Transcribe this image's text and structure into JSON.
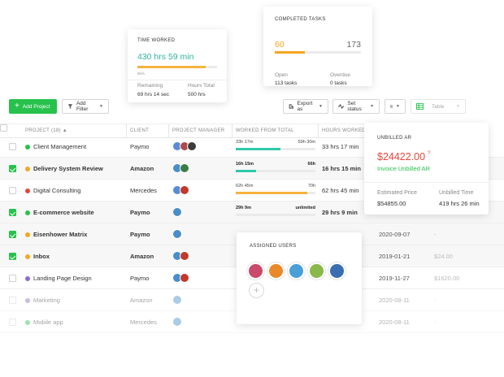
{
  "time_worked": {
    "title": "TIME WORKED",
    "total": "430 hrs 59 min",
    "percent": "86%",
    "percent_value": 0.86,
    "remaining_label": "Remaining",
    "remaining_value": "69 hrs 14 sec",
    "hours_total_label": "Hours Total",
    "hours_total_value": "500 hrs"
  },
  "completed_tasks": {
    "title": "COMPLETED TASKS",
    "done": "60",
    "total": "173",
    "done_fraction": 0.35,
    "open_label": "Open",
    "open_value": "113 tasks",
    "overdue_label": "Overdue",
    "overdue_value": "0 tasks"
  },
  "toolbar": {
    "add_project": "Add Project",
    "add_filter": "Add Filter",
    "export": "Export as",
    "set_status": "Set status",
    "table": "Table"
  },
  "table": {
    "headers": {
      "project": "PROJECT (18) ▲",
      "client": "CLIENT",
      "manager": "PROJECT MANAGER",
      "worked": "WORKED FROM TOTAL",
      "hours": "HOURS WORKED"
    },
    "rows": [
      {
        "name": "Client Management",
        "client": "Paymo",
        "dot": "#27c24c",
        "checked": false,
        "worked": "33h 17m",
        "of": "59h 30m",
        "fill": 0.56,
        "bar": "#2fc9a8",
        "hours": "33 hrs 17 min",
        "date": "",
        "money": "",
        "avatars": [
          "#5b8bd1",
          "#b04a4a",
          "#3c3c3c"
        ]
      },
      {
        "name": "Delivery System Review",
        "client": "Amazon",
        "dot": "#f5a623",
        "checked": true,
        "worked": "16h 15m",
        "of": "66h",
        "fill": 0.25,
        "bar": "#2fc9a8",
        "hours": "16 hrs 15 min",
        "date": "",
        "money": "",
        "avatars": [
          "#4a8ec9",
          "#3a7d44"
        ]
      },
      {
        "name": "Digital Consulting",
        "client": "Mercedes",
        "dot": "#e8443a",
        "checked": false,
        "worked": "62h 45m",
        "of": "70h",
        "fill": 0.9,
        "bar": "#f5b43c",
        "hours": "62 hrs 45 min",
        "date": "",
        "money": "",
        "avatars": [
          "#5b8bd1",
          "#c0392b"
        ]
      },
      {
        "name": "E-commerce website",
        "client": "Paymo",
        "dot": "#27c24c",
        "checked": true,
        "worked": "29h 9m",
        "of": "unlimited",
        "fill": 0,
        "bar": "#2fc9a8",
        "hours": "29 hrs 9 min",
        "date": "",
        "money": "",
        "avatars": [
          "#4a8ec9"
        ]
      },
      {
        "name": "Eisenhower Matrix",
        "client": "Paymo",
        "dot": "#f5a623",
        "checked": true,
        "worked": "",
        "of": "",
        "fill": 0,
        "bar": "#2fc9a8",
        "hours": "",
        "date": "2020-09-07",
        "money": "-",
        "avatars": [
          "#4a8ec9"
        ]
      },
      {
        "name": "Inbox",
        "client": "Amazon",
        "dot": "#f5a623",
        "checked": true,
        "worked": "",
        "of": "",
        "fill": 0,
        "bar": "#2fc9a8",
        "hours": "",
        "date": "2019-01-21",
        "money": "$24.00",
        "avatars": [
          "#4a8ec9",
          "#c0392b"
        ]
      },
      {
        "name": "Landing Page Design",
        "client": "Paymo",
        "dot": "#8e6bd1",
        "checked": false,
        "worked": "",
        "of": "",
        "fill": 0,
        "bar": "#2fc9a8",
        "hours": "",
        "date": "2019-11-27",
        "money": "$1620.00",
        "avatars": [
          "#4a8ec9",
          "#c0392b"
        ]
      },
      {
        "name": "Marketing",
        "client": "Amazon",
        "dot": "#8e6bd1",
        "checked": false,
        "worked": "",
        "of": "",
        "fill": 0,
        "bar": "#2fc9a8",
        "hours": "",
        "date": "2020-08-11",
        "money": "-",
        "avatars": [
          "#4a8ec9"
        ]
      },
      {
        "name": "Mobile app",
        "client": "Mercedes",
        "dot": "#27c24c",
        "checked": false,
        "worked": "",
        "of": "",
        "fill": 0,
        "bar": "#2fc9a8",
        "hours": "",
        "date": "2020-08-11",
        "money": "-",
        "avatars": [
          "#4a8ec9"
        ]
      }
    ]
  },
  "unbilled": {
    "title": "UNBILLED AR",
    "amount": "$24422.00",
    "invoice": "Invoice Unbilled AR",
    "price_label": "Estimated Price",
    "price_value": "$54855.00",
    "time_label": "Unbilled Time",
    "time_value": "419 hrs 26 min"
  },
  "assigned": {
    "title": "ASSIGNED USERS",
    "users": [
      "#c94a6a",
      "#e98a2a",
      "#4a9fd6",
      "#8ab84a",
      "#3b6db3"
    ]
  },
  "colors": {
    "green": "#27c24c",
    "teal": "#2fc9a8",
    "orange": "#f5a623",
    "red": "#e8443a"
  }
}
